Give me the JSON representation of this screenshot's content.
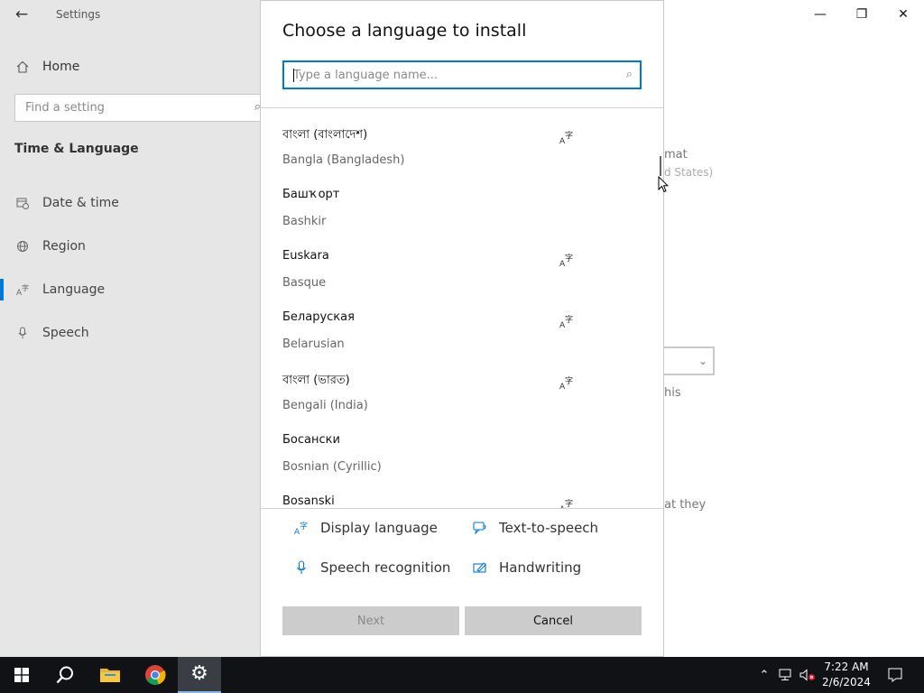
{
  "settings": {
    "title": "Settings",
    "home": "Home",
    "find_placeholder": "Find a setting",
    "section": "Time & Language",
    "nav": [
      {
        "label": "Date & time",
        "icon": "calendar-clock-icon"
      },
      {
        "label": "Region",
        "icon": "globe-icon"
      },
      {
        "label": "Language",
        "icon": "language-icon"
      },
      {
        "label": "Speech",
        "icon": "microphone-icon"
      }
    ],
    "active_nav": "Language",
    "content_fragments": {
      "format": "mat",
      "format_sub": "d States)",
      "this": "his",
      "at_they": "at they"
    }
  },
  "dialog": {
    "title": "Choose a language to install",
    "search_placeholder": "Type a language name...",
    "languages": [
      {
        "native": "বাংলা (বাংলাদেশ)",
        "english": "Bangla (Bangladesh)",
        "display_language": true
      },
      {
        "native": "Башҡорт",
        "english": "Bashkir",
        "display_language": false
      },
      {
        "native": "Euskara",
        "english": "Basque",
        "display_language": true
      },
      {
        "native": "Беларуская",
        "english": "Belarusian",
        "display_language": true
      },
      {
        "native": "বাংলা (ভারত)",
        "english": "Bengali (India)",
        "display_language": true
      },
      {
        "native": "Босански",
        "english": "Bosnian (Cyrillic)",
        "display_language": false
      },
      {
        "native": "Bosanski",
        "english": "",
        "display_language": true
      }
    ],
    "features": {
      "display_language": "Display language",
      "text_to_speech": "Text-to-speech",
      "speech_recognition": "Speech recognition",
      "handwriting": "Handwriting"
    },
    "next": "Next",
    "cancel": "Cancel"
  },
  "taskbar": {
    "time": "7:22 AM",
    "date": "2/6/2024"
  },
  "colors": {
    "accent": "#0078d7",
    "sidebar_bg": "#e6e6e6",
    "taskbar_bg": "#111215"
  }
}
